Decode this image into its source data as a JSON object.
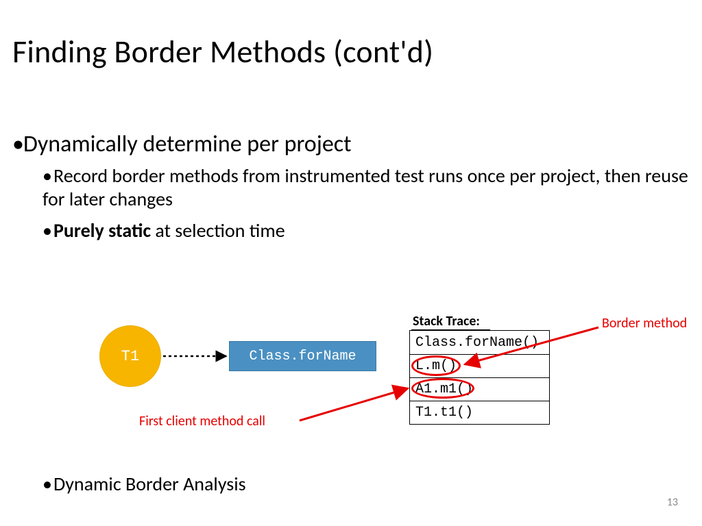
{
  "title": "Finding Border Methods (cont'd)",
  "bullets": {
    "l1_a": "Dynamically determine per project",
    "l2_a": "Record border methods from instrumented test runs once per project, then reuse for later changes",
    "l2_b_bold": "Purely static",
    "l2_b_rest": " at selection time",
    "l2_c": "Dynamic Border Analysis"
  },
  "diagram": {
    "t1": "T1",
    "class_for_name": "Class.forName",
    "stack_title": "Stack Trace:",
    "stack": [
      "Class.forName()",
      "L.m()",
      "A1.m1()",
      "T1.t1()"
    ],
    "label_border": "Border method",
    "label_first": "First client method call"
  },
  "page_number": "13"
}
